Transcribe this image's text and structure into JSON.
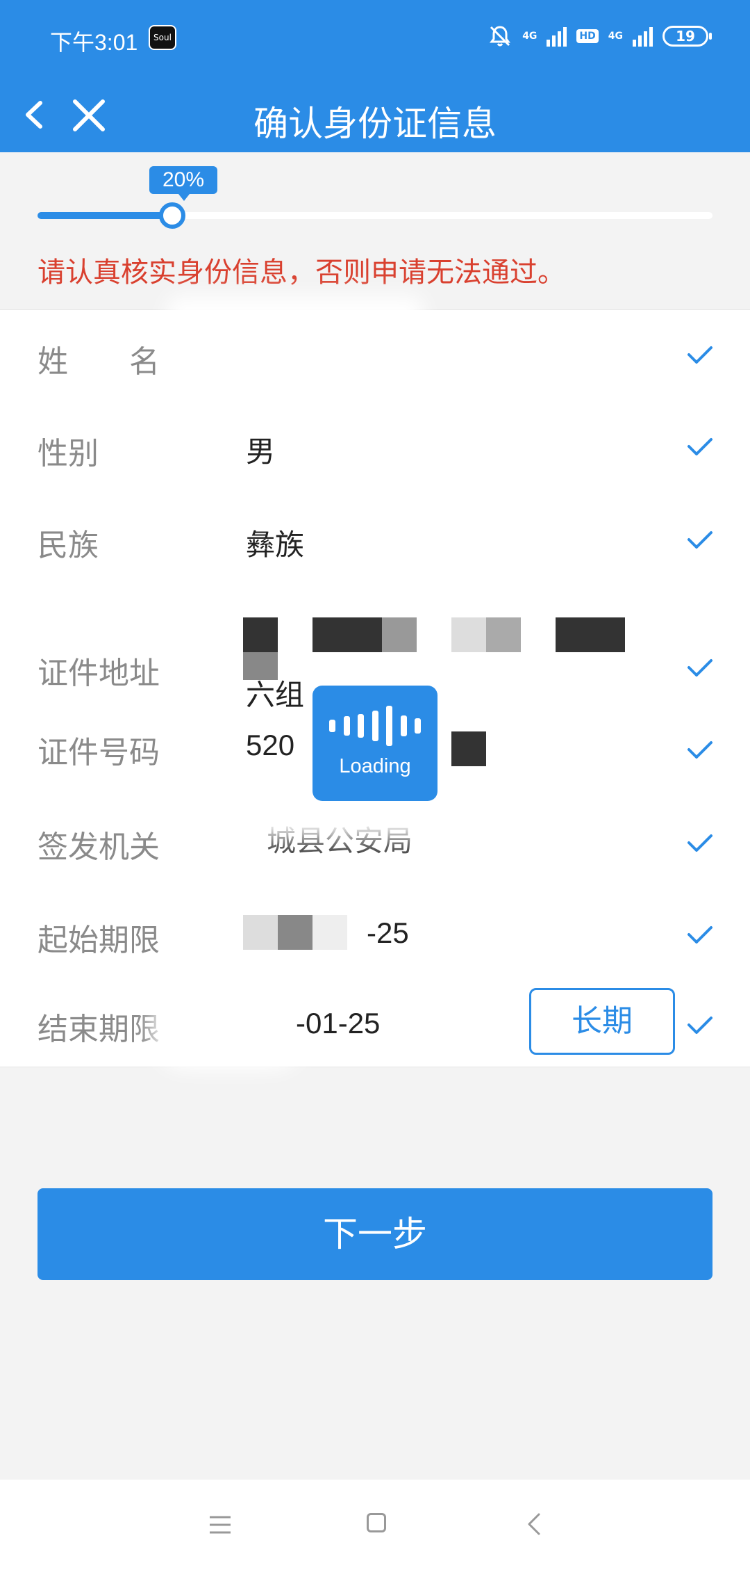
{
  "status_bar": {
    "time": "下午3:01",
    "app_icon_text": "Soul",
    "network_1": "4G",
    "hd": "HD",
    "network_2": "4G",
    "battery": "19"
  },
  "nav": {
    "title": "确认身份证信息"
  },
  "progress": {
    "label": "20%",
    "value": 0.2
  },
  "warning": "请认真核实身份信息，否则申请无法通过。",
  "form": {
    "rows": [
      {
        "label": "姓　　名",
        "value": ""
      },
      {
        "label": "性别",
        "value": "男"
      },
      {
        "label": "民族",
        "value": "彝族"
      },
      {
        "label": "证件地址",
        "value": "六组"
      },
      {
        "label": "证件号码",
        "value": "520"
      },
      {
        "label": "签发机关",
        "value": "城县公安局"
      },
      {
        "label": "起始期限",
        "value": "-25"
      },
      {
        "label": "结束期限",
        "value": "-01-25"
      }
    ],
    "long_term_label": "长期"
  },
  "loading": {
    "text": "Loading"
  },
  "next_button": "下一步",
  "colors": {
    "primary": "#2b8ce6",
    "warning": "#d9402f",
    "label": "#8a8a8a"
  }
}
